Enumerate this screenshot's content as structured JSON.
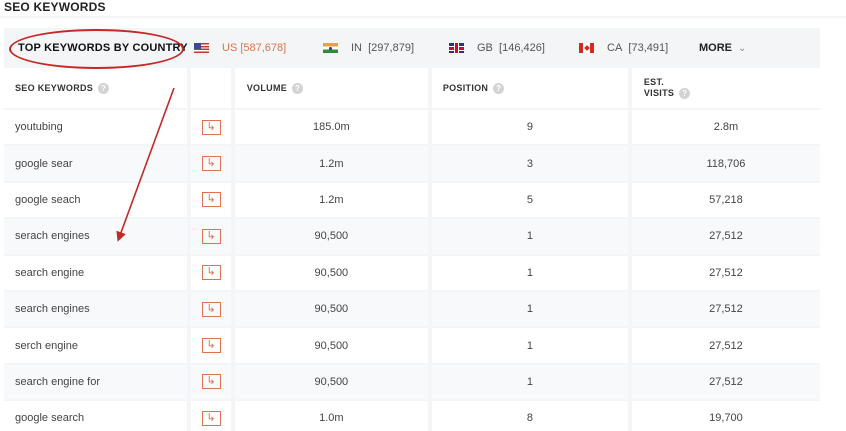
{
  "section": {
    "title": "SEO KEYWORDS"
  },
  "country_bar": {
    "label": "TOP KEYWORDS BY COUNTRY",
    "countries": [
      {
        "code": "US",
        "count": "[587,678]",
        "flag": "us-flag-icon",
        "active": true
      },
      {
        "code": "IN",
        "count": "[297,879]",
        "flag": "india-flag-icon",
        "active": false
      },
      {
        "code": "GB",
        "count": "[146,426]",
        "flag": "uk-flag-icon",
        "active": false
      },
      {
        "code": "CA",
        "count": "[73,491]",
        "flag": "canada-flag-icon",
        "active": false
      }
    ],
    "more_label": "MORE"
  },
  "table": {
    "headers": {
      "keyword": "SEO KEYWORDS",
      "volume": "VOLUME",
      "position": "POSITION",
      "visits_line1": "EST.",
      "visits_line2": "VISITS"
    },
    "rows": [
      {
        "keyword": "youtubing",
        "volume": "185.0m",
        "position": "9",
        "visits": "2.8m"
      },
      {
        "keyword": "google sear",
        "volume": "1.2m",
        "position": "3",
        "visits": "118,706"
      },
      {
        "keyword": "google seach",
        "volume": "1.2m",
        "position": "5",
        "visits": "57,218"
      },
      {
        "keyword": "serach engines",
        "volume": "90,500",
        "position": "1",
        "visits": "27,512"
      },
      {
        "keyword": "search engine",
        "volume": "90,500",
        "position": "1",
        "visits": "27,512"
      },
      {
        "keyword": "search engines",
        "volume": "90,500",
        "position": "1",
        "visits": "27,512"
      },
      {
        "keyword": "serch engine",
        "volume": "90,500",
        "position": "1",
        "visits": "27,512"
      },
      {
        "keyword": "search engine for",
        "volume": "90,500",
        "position": "1",
        "visits": "27,512"
      },
      {
        "keyword": "google search",
        "volume": "1.0m",
        "position": "8",
        "visits": "19,700"
      }
    ]
  },
  "colors": {
    "accent": "#e0734a",
    "annotation": "#c62828",
    "panel_bg": "#f4f5f7"
  }
}
